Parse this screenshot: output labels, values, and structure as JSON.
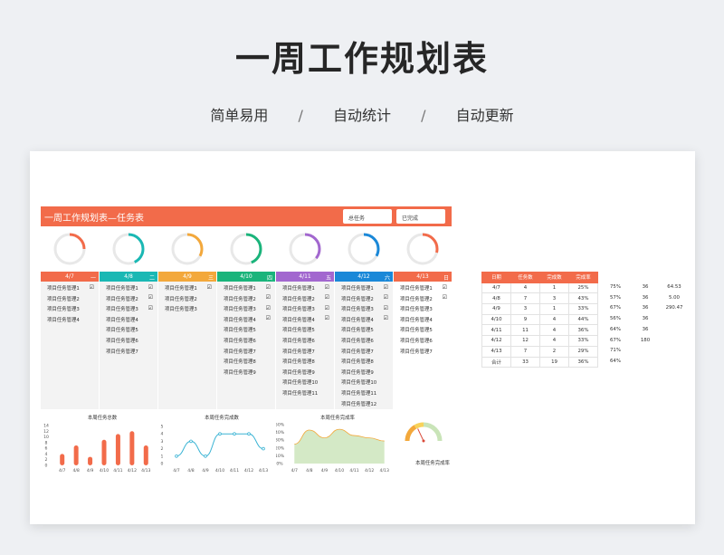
{
  "hero": {
    "title": "一周工作规划表",
    "subtitle_items": [
      "简单易用",
      "/",
      "自动统计",
      "/",
      "自动更新"
    ]
  },
  "header": {
    "title": "一周工作规划表—任务表",
    "total_label": "总任务",
    "done_label": "已完成"
  },
  "colors": {
    "accent": "#f26b4a",
    "days": [
      "#f26b4a",
      "#1ab8b4",
      "#f3a83b",
      "#1ab47b",
      "#a267cf",
      "#1a88d8",
      "#f26b4a"
    ],
    "area": "#c9e4b8",
    "line_blue": "#3bb4d4"
  },
  "days": [
    {
      "date": "4/7",
      "weekday": "一",
      "tasks": [
        "项目任务管理1",
        "项目任务管理2",
        "项目任务管理3",
        "项目任务管理4"
      ],
      "checked": [
        true,
        false,
        false,
        false
      ],
      "ring_pct": 0.25
    },
    {
      "date": "4/8",
      "weekday": "二",
      "tasks": [
        "项目任务管理1",
        "项目任务管理2",
        "项目任务管理3",
        "项目任务管理4",
        "项目任务管理5",
        "项目任务管理6",
        "项目任务管理7"
      ],
      "checked": [
        true,
        true,
        true,
        false,
        false,
        false,
        false
      ],
      "ring_pct": 0.43
    },
    {
      "date": "4/9",
      "weekday": "三",
      "tasks": [
        "项目任务管理1",
        "项目任务管理2",
        "项目任务管理3"
      ],
      "checked": [
        true,
        false,
        false
      ],
      "ring_pct": 0.33
    },
    {
      "date": "4/10",
      "weekday": "四",
      "tasks": [
        "项目任务管理1",
        "项目任务管理2",
        "项目任务管理3",
        "项目任务管理4",
        "项目任务管理5",
        "项目任务管理6",
        "项目任务管理7",
        "项目任务管理8",
        "项目任务管理9"
      ],
      "checked": [
        true,
        true,
        true,
        true,
        false,
        false,
        false,
        false,
        false
      ],
      "ring_pct": 0.44
    },
    {
      "date": "4/11",
      "weekday": "五",
      "tasks": [
        "项目任务管理1",
        "项目任务管理2",
        "项目任务管理3",
        "项目任务管理4",
        "项目任务管理5",
        "项目任务管理6",
        "项目任务管理7",
        "项目任务管理8",
        "项目任务管理9",
        "项目任务管理10",
        "项目任务管理11"
      ],
      "checked": [
        true,
        true,
        true,
        true,
        false,
        false,
        false,
        false,
        false,
        false,
        false
      ],
      "ring_pct": 0.36
    },
    {
      "date": "4/12",
      "weekday": "六",
      "tasks": [
        "项目任务管理1",
        "项目任务管理2",
        "项目任务管理3",
        "项目任务管理4",
        "项目任务管理5",
        "项目任务管理6",
        "项目任务管理7",
        "项目任务管理8",
        "项目任务管理9",
        "项目任务管理10",
        "项目任务管理11",
        "项目任务管理12"
      ],
      "checked": [
        true,
        true,
        true,
        true,
        false,
        false,
        false,
        false,
        false,
        false,
        false,
        false
      ],
      "ring_pct": 0.33
    },
    {
      "date": "4/13",
      "weekday": "日",
      "tasks": [
        "项目任务管理1",
        "项目任务管理2",
        "项目任务管理3",
        "项目任务管理4",
        "项目任务管理5",
        "项目任务管理6",
        "项目任务管理7"
      ],
      "checked": [
        true,
        true,
        false,
        false,
        false,
        false,
        false
      ],
      "ring_pct": 0.29
    }
  ],
  "summary_table": {
    "headers": [
      "日期",
      "任务数",
      "完成数",
      "完成率"
    ],
    "rows": [
      [
        "4/7",
        "4",
        "1",
        "25%"
      ],
      [
        "4/8",
        "7",
        "3",
        "43%"
      ],
      [
        "4/9",
        "3",
        "1",
        "33%"
      ],
      [
        "4/10",
        "9",
        "4",
        "44%"
      ],
      [
        "4/11",
        "11",
        "4",
        "36%"
      ],
      [
        "4/12",
        "12",
        "4",
        "33%"
      ],
      [
        "4/13",
        "7",
        "2",
        "29%"
      ],
      [
        "合计",
        "33",
        "19",
        "36%"
      ]
    ]
  },
  "extra_columns": [
    [
      "75%",
      "36",
      "64.53"
    ],
    [
      "57%",
      "36",
      "5.00"
    ],
    [
      "67%",
      "36",
      "290.47"
    ],
    [
      "56%",
      "36",
      ""
    ],
    [
      "64%",
      "36",
      ""
    ],
    [
      "67%",
      "180",
      ""
    ],
    [
      "71%",
      "",
      ""
    ],
    [
      "64%",
      "",
      ""
    ]
  ],
  "chart_data": [
    {
      "type": "bar",
      "title": "本周任务总数",
      "categories": [
        "4/7",
        "4/8",
        "4/9",
        "4/10",
        "4/11",
        "4/12",
        "4/13"
      ],
      "values": [
        4,
        7,
        3,
        9,
        11,
        12,
        7
      ],
      "ylim": [
        0,
        14
      ],
      "yticks": [
        "14",
        "12",
        "10",
        "8",
        "6",
        "4",
        "2",
        "0"
      ]
    },
    {
      "type": "line",
      "title": "本周任务完成数",
      "categories": [
        "4/7",
        "4/8",
        "4/9",
        "4/10",
        "4/11",
        "4/12",
        "4/13"
      ],
      "values": [
        1,
        3,
        1,
        4,
        4,
        4,
        2
      ],
      "ylim": [
        0,
        5
      ],
      "yticks": [
        "5",
        "4",
        "3",
        "2",
        "1",
        "0"
      ]
    },
    {
      "type": "area",
      "title": "本周任务完成率",
      "categories": [
        "4/7",
        "4/8",
        "4/9",
        "4/10",
        "4/11",
        "4/12",
        "4/13"
      ],
      "values": [
        25,
        43,
        33,
        44,
        36,
        33,
        29
      ],
      "ylim": [
        0,
        50
      ],
      "yticks": [
        "50%",
        "40%",
        "30%",
        "20%",
        "10%",
        "0%"
      ]
    },
    {
      "type": "gauge",
      "title": "本周任务完成率",
      "value": 36
    }
  ]
}
